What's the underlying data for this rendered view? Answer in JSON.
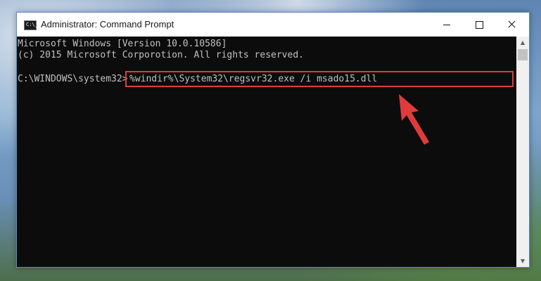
{
  "window": {
    "title": "Administrator: Command Prompt",
    "icon_glyph": "C:\\_"
  },
  "controls": {
    "minimize": "minimize-icon",
    "maximize": "maximize-icon",
    "close": "close-icon"
  },
  "console": {
    "line1": "Microsoft Windows [Version 10.0.10586]",
    "line2": "(c) 2015 Microsoft Corporotion. All rights reserved.",
    "prompt": "C:\\WINDOWS\\system32>",
    "command": "%windir%\\System32\\regsvr32.exe /i msado15.dll"
  },
  "annotation": {
    "highlight_color": "#e03b3b",
    "arrow_color": "#e03b3b"
  }
}
